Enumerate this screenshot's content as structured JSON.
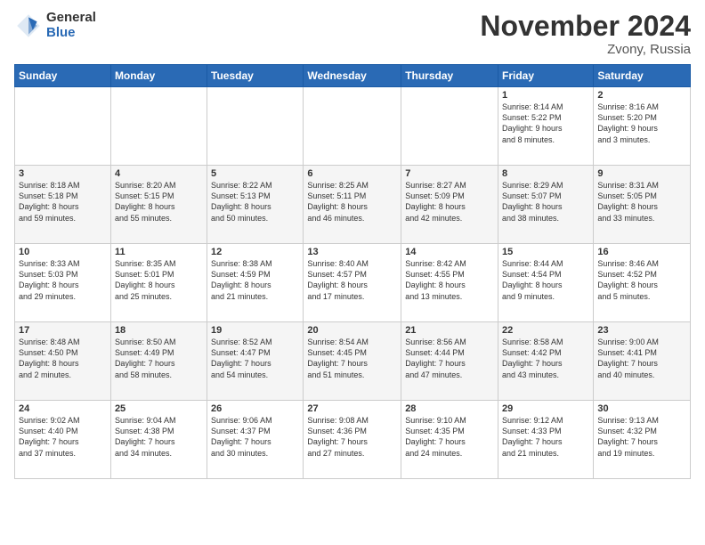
{
  "header": {
    "logo_general": "General",
    "logo_blue": "Blue",
    "month_title": "November 2024",
    "location": "Zvony, Russia"
  },
  "weekdays": [
    "Sunday",
    "Monday",
    "Tuesday",
    "Wednesday",
    "Thursday",
    "Friday",
    "Saturday"
  ],
  "weeks": [
    [
      {
        "day": "",
        "info": ""
      },
      {
        "day": "",
        "info": ""
      },
      {
        "day": "",
        "info": ""
      },
      {
        "day": "",
        "info": ""
      },
      {
        "day": "",
        "info": ""
      },
      {
        "day": "1",
        "info": "Sunrise: 8:14 AM\nSunset: 5:22 PM\nDaylight: 9 hours\nand 8 minutes."
      },
      {
        "day": "2",
        "info": "Sunrise: 8:16 AM\nSunset: 5:20 PM\nDaylight: 9 hours\nand 3 minutes."
      }
    ],
    [
      {
        "day": "3",
        "info": "Sunrise: 8:18 AM\nSunset: 5:18 PM\nDaylight: 8 hours\nand 59 minutes."
      },
      {
        "day": "4",
        "info": "Sunrise: 8:20 AM\nSunset: 5:15 PM\nDaylight: 8 hours\nand 55 minutes."
      },
      {
        "day": "5",
        "info": "Sunrise: 8:22 AM\nSunset: 5:13 PM\nDaylight: 8 hours\nand 50 minutes."
      },
      {
        "day": "6",
        "info": "Sunrise: 8:25 AM\nSunset: 5:11 PM\nDaylight: 8 hours\nand 46 minutes."
      },
      {
        "day": "7",
        "info": "Sunrise: 8:27 AM\nSunset: 5:09 PM\nDaylight: 8 hours\nand 42 minutes."
      },
      {
        "day": "8",
        "info": "Sunrise: 8:29 AM\nSunset: 5:07 PM\nDaylight: 8 hours\nand 38 minutes."
      },
      {
        "day": "9",
        "info": "Sunrise: 8:31 AM\nSunset: 5:05 PM\nDaylight: 8 hours\nand 33 minutes."
      }
    ],
    [
      {
        "day": "10",
        "info": "Sunrise: 8:33 AM\nSunset: 5:03 PM\nDaylight: 8 hours\nand 29 minutes."
      },
      {
        "day": "11",
        "info": "Sunrise: 8:35 AM\nSunset: 5:01 PM\nDaylight: 8 hours\nand 25 minutes."
      },
      {
        "day": "12",
        "info": "Sunrise: 8:38 AM\nSunset: 4:59 PM\nDaylight: 8 hours\nand 21 minutes."
      },
      {
        "day": "13",
        "info": "Sunrise: 8:40 AM\nSunset: 4:57 PM\nDaylight: 8 hours\nand 17 minutes."
      },
      {
        "day": "14",
        "info": "Sunrise: 8:42 AM\nSunset: 4:55 PM\nDaylight: 8 hours\nand 13 minutes."
      },
      {
        "day": "15",
        "info": "Sunrise: 8:44 AM\nSunset: 4:54 PM\nDaylight: 8 hours\nand 9 minutes."
      },
      {
        "day": "16",
        "info": "Sunrise: 8:46 AM\nSunset: 4:52 PM\nDaylight: 8 hours\nand 5 minutes."
      }
    ],
    [
      {
        "day": "17",
        "info": "Sunrise: 8:48 AM\nSunset: 4:50 PM\nDaylight: 8 hours\nand 2 minutes."
      },
      {
        "day": "18",
        "info": "Sunrise: 8:50 AM\nSunset: 4:49 PM\nDaylight: 7 hours\nand 58 minutes."
      },
      {
        "day": "19",
        "info": "Sunrise: 8:52 AM\nSunset: 4:47 PM\nDaylight: 7 hours\nand 54 minutes."
      },
      {
        "day": "20",
        "info": "Sunrise: 8:54 AM\nSunset: 4:45 PM\nDaylight: 7 hours\nand 51 minutes."
      },
      {
        "day": "21",
        "info": "Sunrise: 8:56 AM\nSunset: 4:44 PM\nDaylight: 7 hours\nand 47 minutes."
      },
      {
        "day": "22",
        "info": "Sunrise: 8:58 AM\nSunset: 4:42 PM\nDaylight: 7 hours\nand 43 minutes."
      },
      {
        "day": "23",
        "info": "Sunrise: 9:00 AM\nSunset: 4:41 PM\nDaylight: 7 hours\nand 40 minutes."
      }
    ],
    [
      {
        "day": "24",
        "info": "Sunrise: 9:02 AM\nSunset: 4:40 PM\nDaylight: 7 hours\nand 37 minutes."
      },
      {
        "day": "25",
        "info": "Sunrise: 9:04 AM\nSunset: 4:38 PM\nDaylight: 7 hours\nand 34 minutes."
      },
      {
        "day": "26",
        "info": "Sunrise: 9:06 AM\nSunset: 4:37 PM\nDaylight: 7 hours\nand 30 minutes."
      },
      {
        "day": "27",
        "info": "Sunrise: 9:08 AM\nSunset: 4:36 PM\nDaylight: 7 hours\nand 27 minutes."
      },
      {
        "day": "28",
        "info": "Sunrise: 9:10 AM\nSunset: 4:35 PM\nDaylight: 7 hours\nand 24 minutes."
      },
      {
        "day": "29",
        "info": "Sunrise: 9:12 AM\nSunset: 4:33 PM\nDaylight: 7 hours\nand 21 minutes."
      },
      {
        "day": "30",
        "info": "Sunrise: 9:13 AM\nSunset: 4:32 PM\nDaylight: 7 hours\nand 19 minutes."
      }
    ]
  ]
}
